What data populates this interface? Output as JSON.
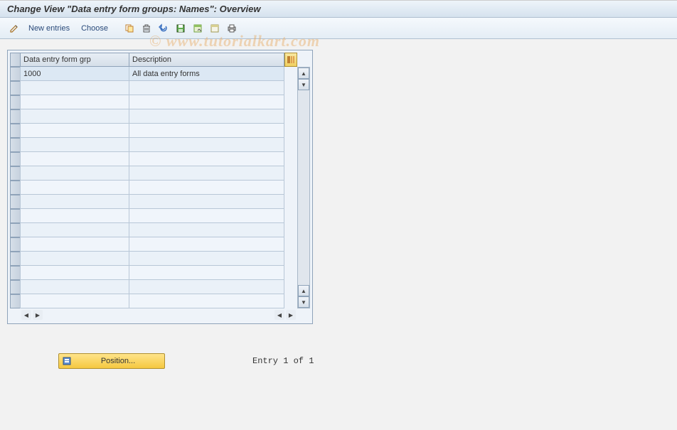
{
  "header": {
    "title": "Change View \"Data entry form groups: Names\": Overview"
  },
  "toolbar": {
    "new_entries": "New entries",
    "choose": "Choose"
  },
  "table": {
    "columns": {
      "col1": "Data entry form grp",
      "col2": "Description"
    },
    "rows": [
      {
        "grp": "1000",
        "desc": "All data entry forms"
      }
    ],
    "empty_row_count": 16
  },
  "position_button": {
    "label": "Position..."
  },
  "status": {
    "text": "Entry 1 of 1"
  },
  "watermark": "© www.tutorialkart.com"
}
